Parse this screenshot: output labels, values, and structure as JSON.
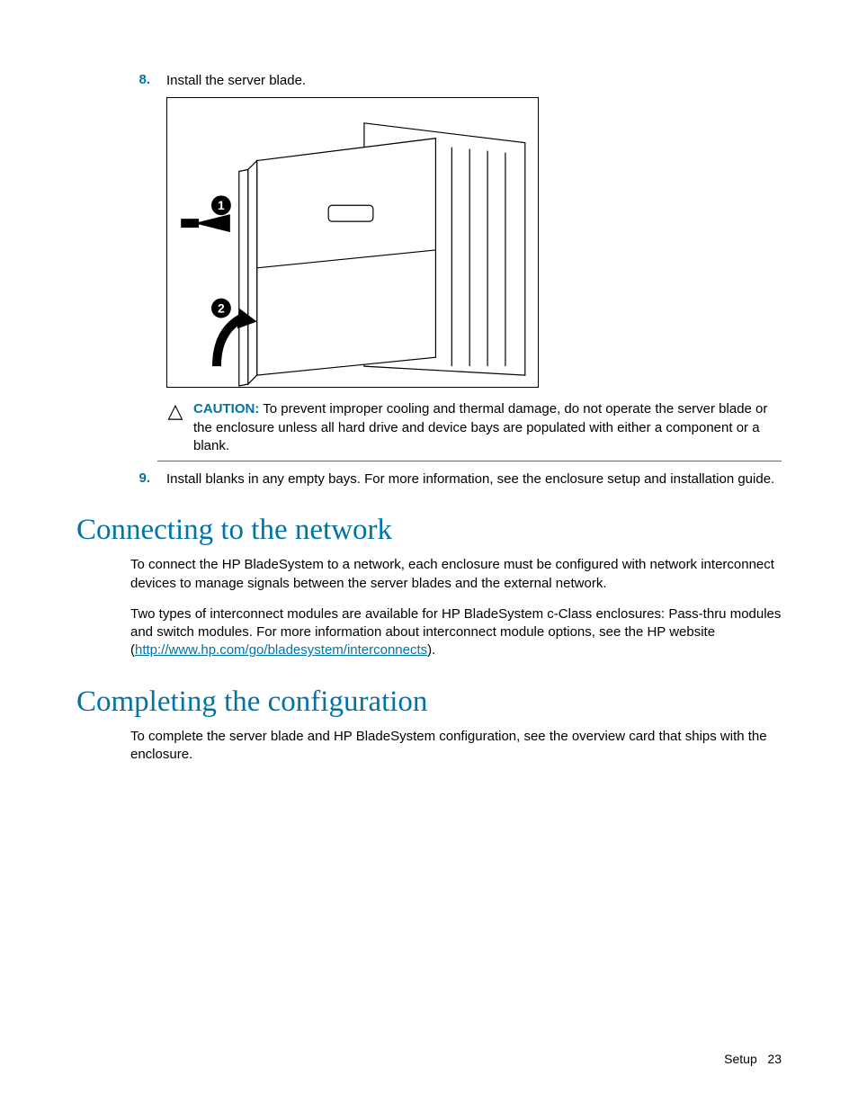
{
  "steps": {
    "s8_num": "8.",
    "s8_text": "Install the server blade.",
    "s9_num": "9.",
    "s9_text": "Install blanks in any empty bays. For more information, see the enclosure setup and installation guide."
  },
  "caution": {
    "label": "CAUTION:",
    "text": " To prevent improper cooling and thermal damage, do not operate the server blade or the enclosure unless all hard drive and device bays are populated with either a component or a blank."
  },
  "headings": {
    "h1": "Connecting to the network",
    "h2": "Completing the configuration"
  },
  "paragraphs": {
    "p1": "To connect the HP BladeSystem to a network, each enclosure must be configured with network interconnect devices to manage signals between the server blades and the external network.",
    "p2a": "Two types of interconnect modules are available for HP BladeSystem c-Class enclosures: Pass-thru modules and switch modules. For more information about interconnect module options, see the HP website (",
    "p2_link": "http://www.hp.com/go/bladesystem/interconnects",
    "p2b": ").",
    "p3": "To complete the server blade and HP BladeSystem configuration, see the overview card that ships with the enclosure."
  },
  "footer": {
    "section": "Setup",
    "page": "23"
  }
}
